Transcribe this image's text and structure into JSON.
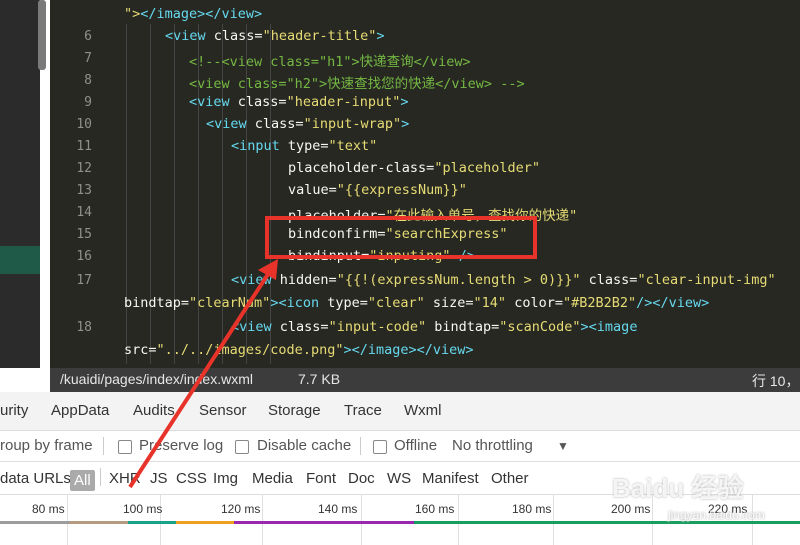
{
  "editor": {
    "lines": [
      {
        "num": "",
        "segments": [
          {
            "c": "str",
            "t": "\">"
          },
          {
            "c": "tag",
            "t": "</image></view>"
          }
        ]
      },
      {
        "num": "6",
        "segments": [
          {
            "c": "tag",
            "t": "<view "
          },
          {
            "c": "attr",
            "t": "class="
          },
          {
            "c": "str",
            "t": "\"header-title\""
          },
          {
            "c": "tag",
            "t": ">"
          }
        ]
      },
      {
        "num": "7",
        "segments": [
          {
            "c": "cmt",
            "t": "<!--<view class=\"h1\">快递查询</view>"
          }
        ]
      },
      {
        "num": "8",
        "segments": [
          {
            "c": "cmt",
            "t": "<view class=\"h2\">快速查找您的快递</view> -->"
          }
        ]
      },
      {
        "num": "9",
        "segments": [
          {
            "c": "tag",
            "t": "<view "
          },
          {
            "c": "attr",
            "t": "class="
          },
          {
            "c": "str",
            "t": "\"header-input\""
          },
          {
            "c": "tag",
            "t": ">"
          }
        ]
      },
      {
        "num": "10",
        "segments": [
          {
            "c": "tag",
            "t": "<view "
          },
          {
            "c": "attr",
            "t": "class="
          },
          {
            "c": "str",
            "t": "\"input-wrap\""
          },
          {
            "c": "tag",
            "t": ">"
          }
        ]
      },
      {
        "num": "11",
        "segments": [
          {
            "c": "tag",
            "t": "<input "
          },
          {
            "c": "attr",
            "t": "type="
          },
          {
            "c": "str",
            "t": "\"text\""
          }
        ]
      },
      {
        "num": "12",
        "segments": [
          {
            "c": "attr",
            "t": "placeholder-class="
          },
          {
            "c": "str",
            "t": "\"placeholder\""
          }
        ]
      },
      {
        "num": "13",
        "segments": [
          {
            "c": "attr",
            "t": "value="
          },
          {
            "c": "str",
            "t": "\"{{expressNum}}\""
          }
        ]
      },
      {
        "num": "14",
        "segments": [
          {
            "c": "attr",
            "t": "placeholder="
          },
          {
            "c": "str",
            "t": "\"在此输入单号，查找你的快递\""
          }
        ]
      },
      {
        "num": "15",
        "segments": [
          {
            "c": "attr",
            "t": "bindconfirm="
          },
          {
            "c": "str",
            "t": "\"searchExpress\""
          }
        ]
      },
      {
        "num": "16",
        "segments": [
          {
            "c": "attr",
            "t": "bindinput="
          },
          {
            "c": "str",
            "t": "\"inputing\""
          },
          {
            "c": "tag",
            "t": " />"
          }
        ]
      },
      {
        "num": "17",
        "segments": [
          {
            "c": "tag",
            "t": "<view "
          },
          {
            "c": "attr",
            "t": "hidden="
          },
          {
            "c": "str",
            "t": "\"{{!(expressNum.length > 0)}}\""
          },
          {
            "c": "attr",
            "t": " class="
          },
          {
            "c": "str",
            "t": "\"clear-input-img\""
          }
        ]
      },
      {
        "num": "",
        "segments": [
          {
            "c": "attr",
            "t": "bindtap="
          },
          {
            "c": "str",
            "t": "\"clearNum\""
          },
          {
            "c": "tag",
            "t": "><icon "
          },
          {
            "c": "attr",
            "t": "type="
          },
          {
            "c": "str",
            "t": "\"clear\""
          },
          {
            "c": "attr",
            "t": " size="
          },
          {
            "c": "str",
            "t": "\"14\""
          },
          {
            "c": "attr",
            "t": " color="
          },
          {
            "c": "str",
            "t": "\"#B2B2B2\""
          },
          {
            "c": "tag",
            "t": "/></view>"
          }
        ]
      },
      {
        "num": "18",
        "segments": [
          {
            "c": "tag",
            "t": "<view "
          },
          {
            "c": "attr",
            "t": "class="
          },
          {
            "c": "str",
            "t": "\"input-code\""
          },
          {
            "c": "attr",
            "t": " bindtap="
          },
          {
            "c": "str",
            "t": "\"scanCode\""
          },
          {
            "c": "tag",
            "t": "><image"
          }
        ]
      },
      {
        "num": "",
        "segments": [
          {
            "c": "attr",
            "t": "src="
          },
          {
            "c": "str",
            "t": "\"../../images/code.png\""
          },
          {
            "c": "tag",
            "t": "></image></view>"
          }
        ]
      }
    ]
  },
  "statusbar": {
    "path": "/kuaidi/pages/index/index.wxml",
    "size": "7.7 KB",
    "cursor": "行 10，"
  },
  "devtools_tabs": [
    "urity",
    "AppData",
    "Audits",
    "Sensor",
    "Storage",
    "Trace",
    "Wxml"
  ],
  "options": {
    "group_by_frame": "roup by frame",
    "preserve_log": "Preserve log",
    "disable_cache": "Disable cache",
    "offline": "Offline",
    "throttling": "No throttling",
    "dropdown_arrow": "▼"
  },
  "filters": {
    "data_urls": "data URLs",
    "all": "All",
    "types": [
      "XHR",
      "JS",
      "CSS",
      "Img",
      "Media",
      "Font",
      "Doc",
      "WS",
      "Manifest",
      "Other"
    ]
  },
  "timeline": {
    "ticks": [
      "80 ms",
      "100 ms",
      "120 ms",
      "140 ms",
      "160 ms",
      "180 ms",
      "200 ms",
      "220 ms"
    ]
  },
  "watermark": {
    "brand": "Baidu 经验",
    "sub": "jingyan.baidu.com"
  },
  "colors": {
    "highlight": "#e8332a",
    "editor_bg": "#272822"
  }
}
